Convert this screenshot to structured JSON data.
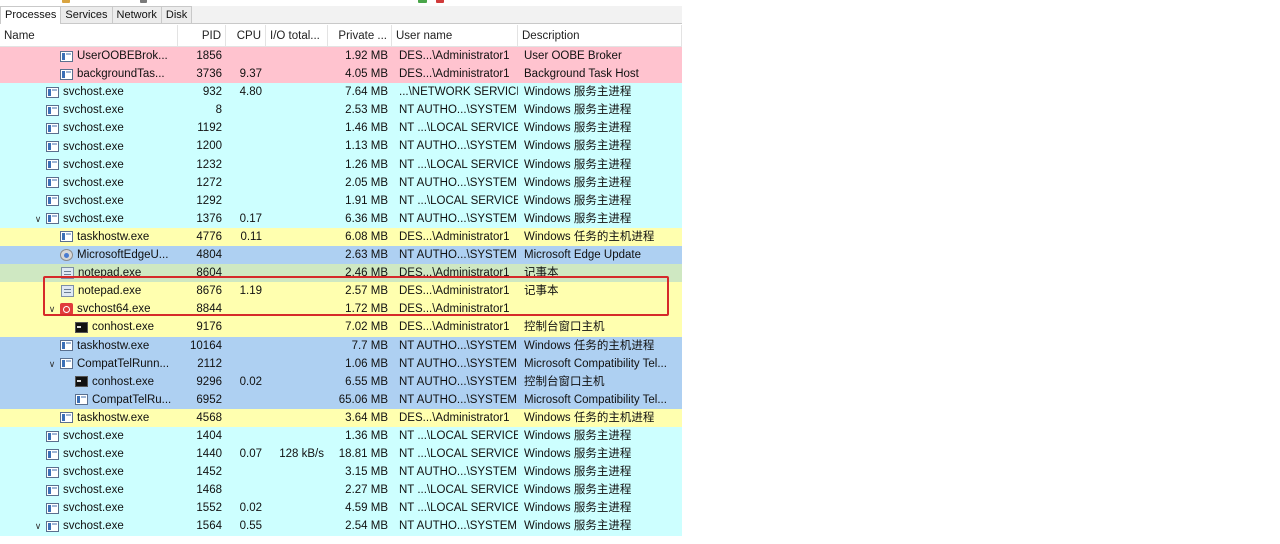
{
  "tabs": [
    {
      "label": "Processes",
      "active": true
    },
    {
      "label": "Services",
      "active": false
    },
    {
      "label": "Network",
      "active": false
    },
    {
      "label": "Disk",
      "active": false
    }
  ],
  "columns": {
    "name": "Name",
    "pid": "PID",
    "cpu": "CPU",
    "io": "I/O total...",
    "priv": "Private ...",
    "user": "User name",
    "desc": "Description"
  },
  "colors": {
    "pink": "#ffc3cf",
    "cyan": "#cdffff",
    "yellow": "#ffffaf",
    "blue": "#aed0f2",
    "green": "#cfe8c2",
    "highlight": "#d62a2a"
  },
  "rows": [
    {
      "indent": 2,
      "chevron": "",
      "icon": "win",
      "name": "UserOOBEBrok...",
      "pid": "1856",
      "cpu": "",
      "io": "",
      "priv": "1.92 MB",
      "user": "DES...\\Administrator1",
      "desc": "User OOBE Broker",
      "color": "pink"
    },
    {
      "indent": 2,
      "chevron": "",
      "icon": "win",
      "name": "backgroundTas...",
      "pid": "3736",
      "cpu": "9.37",
      "io": "",
      "priv": "4.05 MB",
      "user": "DES...\\Administrator1",
      "desc": "Background Task Host",
      "color": "pink"
    },
    {
      "indent": 1,
      "chevron": "",
      "icon": "win",
      "name": "svchost.exe",
      "pid": "932",
      "cpu": "4.80",
      "io": "",
      "priv": "7.64 MB",
      "user": "...\\NETWORK SERVICE",
      "desc": "Windows 服务主进程",
      "color": "cyan"
    },
    {
      "indent": 1,
      "chevron": "",
      "icon": "win",
      "name": "svchost.exe",
      "pid": "8",
      "cpu": "",
      "io": "",
      "priv": "2.53 MB",
      "user": "NT AUTHO...\\SYSTEM",
      "desc": "Windows 服务主进程",
      "color": "cyan"
    },
    {
      "indent": 1,
      "chevron": "",
      "icon": "win",
      "name": "svchost.exe",
      "pid": "1192",
      "cpu": "",
      "io": "",
      "priv": "1.46 MB",
      "user": "NT ...\\LOCAL SERVICE",
      "desc": "Windows 服务主进程",
      "color": "cyan"
    },
    {
      "indent": 1,
      "chevron": "",
      "icon": "win",
      "name": "svchost.exe",
      "pid": "1200",
      "cpu": "",
      "io": "",
      "priv": "1.13 MB",
      "user": "NT AUTHO...\\SYSTEM",
      "desc": "Windows 服务主进程",
      "color": "cyan"
    },
    {
      "indent": 1,
      "chevron": "",
      "icon": "win",
      "name": "svchost.exe",
      "pid": "1232",
      "cpu": "",
      "io": "",
      "priv": "1.26 MB",
      "user": "NT ...\\LOCAL SERVICE",
      "desc": "Windows 服务主进程",
      "color": "cyan"
    },
    {
      "indent": 1,
      "chevron": "",
      "icon": "win",
      "name": "svchost.exe",
      "pid": "1272",
      "cpu": "",
      "io": "",
      "priv": "2.05 MB",
      "user": "NT AUTHO...\\SYSTEM",
      "desc": "Windows 服务主进程",
      "color": "cyan"
    },
    {
      "indent": 1,
      "chevron": "",
      "icon": "win",
      "name": "svchost.exe",
      "pid": "1292",
      "cpu": "",
      "io": "",
      "priv": "1.91 MB",
      "user": "NT ...\\LOCAL SERVICE",
      "desc": "Windows 服务主进程",
      "color": "cyan"
    },
    {
      "indent": 1,
      "chevron": "v",
      "icon": "win",
      "name": "svchost.exe",
      "pid": "1376",
      "cpu": "0.17",
      "io": "",
      "priv": "6.36 MB",
      "user": "NT AUTHO...\\SYSTEM",
      "desc": "Windows 服务主进程",
      "color": "cyan"
    },
    {
      "indent": 2,
      "chevron": "",
      "icon": "win",
      "name": "taskhostw.exe",
      "pid": "4776",
      "cpu": "0.11",
      "io": "",
      "priv": "6.08 MB",
      "user": "DES...\\Administrator1",
      "desc": "Windows 任务的主机进程",
      "color": "yellow"
    },
    {
      "indent": 2,
      "chevron": "",
      "icon": "edge",
      "name": "MicrosoftEdgeU...",
      "pid": "4804",
      "cpu": "",
      "io": "",
      "priv": "2.63 MB",
      "user": "NT AUTHO...\\SYSTEM",
      "desc": "Microsoft Edge Update",
      "color": "blue"
    },
    {
      "indent": 2,
      "chevron": "",
      "icon": "note",
      "name": "notepad.exe",
      "pid": "8604",
      "cpu": "",
      "io": "",
      "priv": "2.46 MB",
      "user": "DES...\\Administrator1",
      "desc": "记事本",
      "color": "green"
    },
    {
      "indent": 2,
      "chevron": "",
      "icon": "note",
      "name": "notepad.exe",
      "pid": "8676",
      "cpu": "1.19",
      "io": "",
      "priv": "2.57 MB",
      "user": "DES...\\Administrator1",
      "desc": "记事本",
      "color": "yellow"
    },
    {
      "indent": 2,
      "chevron": "v",
      "icon": "mal",
      "name": "svchost64.exe",
      "pid": "8844",
      "cpu": "",
      "io": "",
      "priv": "1.72 MB",
      "user": "DES...\\Administrator1",
      "desc": "",
      "color": "yellow"
    },
    {
      "indent": 3,
      "chevron": "",
      "icon": "cmd",
      "name": "conhost.exe",
      "pid": "9176",
      "cpu": "",
      "io": "",
      "priv": "7.02 MB",
      "user": "DES...\\Administrator1",
      "desc": "控制台窗口主机",
      "color": "yellow"
    },
    {
      "indent": 2,
      "chevron": "",
      "icon": "win",
      "name": "taskhostw.exe",
      "pid": "10164",
      "cpu": "",
      "io": "",
      "priv": "7.7 MB",
      "user": "NT AUTHO...\\SYSTEM",
      "desc": "Windows 任务的主机进程",
      "color": "blue"
    },
    {
      "indent": 2,
      "chevron": "v",
      "icon": "win",
      "name": "CompatTelRunn...",
      "pid": "2112",
      "cpu": "",
      "io": "",
      "priv": "1.06 MB",
      "user": "NT AUTHO...\\SYSTEM",
      "desc": "Microsoft Compatibility Tel...",
      "color": "blue"
    },
    {
      "indent": 3,
      "chevron": "",
      "icon": "cmd",
      "name": "conhost.exe",
      "pid": "9296",
      "cpu": "0.02",
      "io": "",
      "priv": "6.55 MB",
      "user": "NT AUTHO...\\SYSTEM",
      "desc": "控制台窗口主机",
      "color": "blue"
    },
    {
      "indent": 3,
      "chevron": "",
      "icon": "win",
      "name": "CompatTelRu...",
      "pid": "6952",
      "cpu": "",
      "io": "",
      "priv": "65.06 MB",
      "user": "NT AUTHO...\\SYSTEM",
      "desc": "Microsoft Compatibility Tel...",
      "color": "blue"
    },
    {
      "indent": 2,
      "chevron": "",
      "icon": "win",
      "name": "taskhostw.exe",
      "pid": "4568",
      "cpu": "",
      "io": "",
      "priv": "3.64 MB",
      "user": "DES...\\Administrator1",
      "desc": "Windows 任务的主机进程",
      "color": "yellow"
    },
    {
      "indent": 1,
      "chevron": "",
      "icon": "win",
      "name": "svchost.exe",
      "pid": "1404",
      "cpu": "",
      "io": "",
      "priv": "1.36 MB",
      "user": "NT ...\\LOCAL SERVICE",
      "desc": "Windows 服务主进程",
      "color": "cyan"
    },
    {
      "indent": 1,
      "chevron": "",
      "icon": "win",
      "name": "svchost.exe",
      "pid": "1440",
      "cpu": "0.07",
      "io": "128 kB/s",
      "priv": "18.81 MB",
      "user": "NT ...\\LOCAL SERVICE",
      "desc": "Windows 服务主进程",
      "color": "cyan"
    },
    {
      "indent": 1,
      "chevron": "",
      "icon": "win",
      "name": "svchost.exe",
      "pid": "1452",
      "cpu": "",
      "io": "",
      "priv": "3.15 MB",
      "user": "NT AUTHO...\\SYSTEM",
      "desc": "Windows 服务主进程",
      "color": "cyan"
    },
    {
      "indent": 1,
      "chevron": "",
      "icon": "win",
      "name": "svchost.exe",
      "pid": "1468",
      "cpu": "",
      "io": "",
      "priv": "2.27 MB",
      "user": "NT ...\\LOCAL SERVICE",
      "desc": "Windows 服务主进程",
      "color": "cyan"
    },
    {
      "indent": 1,
      "chevron": "",
      "icon": "win",
      "name": "svchost.exe",
      "pid": "1552",
      "cpu": "0.02",
      "io": "",
      "priv": "4.59 MB",
      "user": "NT ...\\LOCAL SERVICE",
      "desc": "Windows 服务主进程",
      "color": "cyan"
    },
    {
      "indent": 1,
      "chevron": "v",
      "icon": "win",
      "name": "svchost.exe",
      "pid": "1564",
      "cpu": "0.55",
      "io": "",
      "priv": "2.54 MB",
      "user": "NT AUTHO...\\SYSTEM",
      "desc": "Windows 服务主进程",
      "color": "cyan"
    }
  ]
}
